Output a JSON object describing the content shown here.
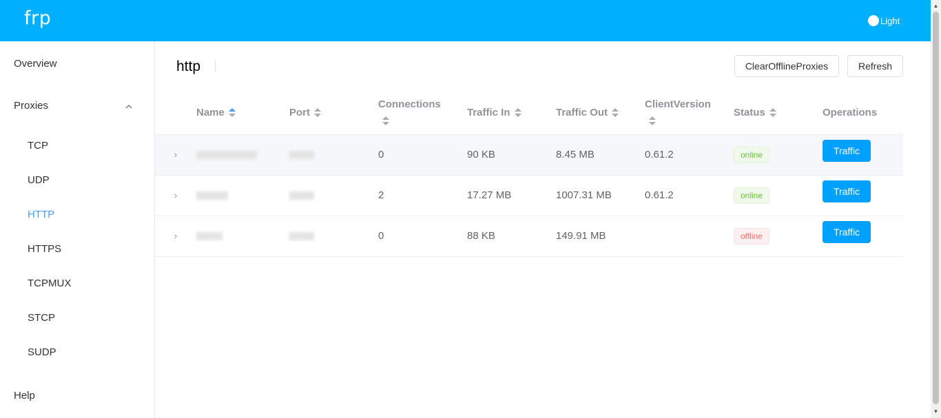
{
  "app": {
    "brand": "frp",
    "theme_label": "Light"
  },
  "sidebar": {
    "overview": "Overview",
    "proxies": "Proxies",
    "items": [
      "TCP",
      "UDP",
      "HTTP",
      "HTTPS",
      "TCPMUX",
      "STCP",
      "SUDP"
    ],
    "active": "HTTP",
    "help": "Help"
  },
  "page": {
    "title": "http",
    "clear_button": "ClearOfflineProxies",
    "refresh_button": "Refresh"
  },
  "table": {
    "columns": {
      "name": "Name",
      "port": "Port",
      "connections": "Connections",
      "traffic_in": "Traffic In",
      "traffic_out": "Traffic Out",
      "client_version": "ClientVersion",
      "status": "Status",
      "operations": "Operations"
    },
    "rows": [
      {
        "connections": "0",
        "traffic_in": "90 KB",
        "traffic_out": "8.45 MB",
        "client_version": "0.61.2",
        "status": "online",
        "action": "Traffic"
      },
      {
        "connections": "2",
        "traffic_in": "17.27 MB",
        "traffic_out": "1007.31 MB",
        "client_version": "0.61.2",
        "status": "online",
        "action": "Traffic"
      },
      {
        "connections": "0",
        "traffic_in": "88 KB",
        "traffic_out": "149.91 MB",
        "client_version": "",
        "status": "offline",
        "action": "Traffic"
      }
    ]
  },
  "colors": {
    "header": "#00b0ff",
    "accent": "#409eff",
    "button": "#00a0ff",
    "online": "#67c23a",
    "offline": "#f56c6c"
  }
}
